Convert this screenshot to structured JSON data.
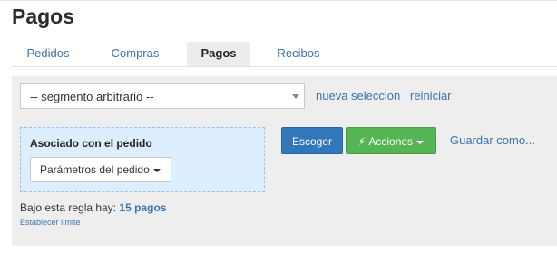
{
  "page": {
    "title": "Pagos"
  },
  "tabs": [
    {
      "label": "Pedidos",
      "active": false
    },
    {
      "label": "Compras",
      "active": false
    },
    {
      "label": "Pagos",
      "active": true
    },
    {
      "label": "Recibos",
      "active": false
    }
  ],
  "segment": {
    "selected": "-- segmento arbitrario --",
    "new_selection_link": "nueva seleccion",
    "restart_link": "reiniciar"
  },
  "criteria": {
    "title": "Asociado con el pedido",
    "params_button": "Parámetros del pedido"
  },
  "actions": {
    "choose_button": "Escoger",
    "actions_button": "Acciones",
    "save_as_link": "Guardar como..."
  },
  "summary": {
    "prefix": "Bajo esta regla hay:",
    "count": "15 pagos",
    "limit_link": "Establecer límite"
  },
  "colors": {
    "link": "#3a73b0",
    "primary_button": "#3377bb",
    "success_button": "#55b555",
    "criteria_bg": "#ddeeff"
  }
}
